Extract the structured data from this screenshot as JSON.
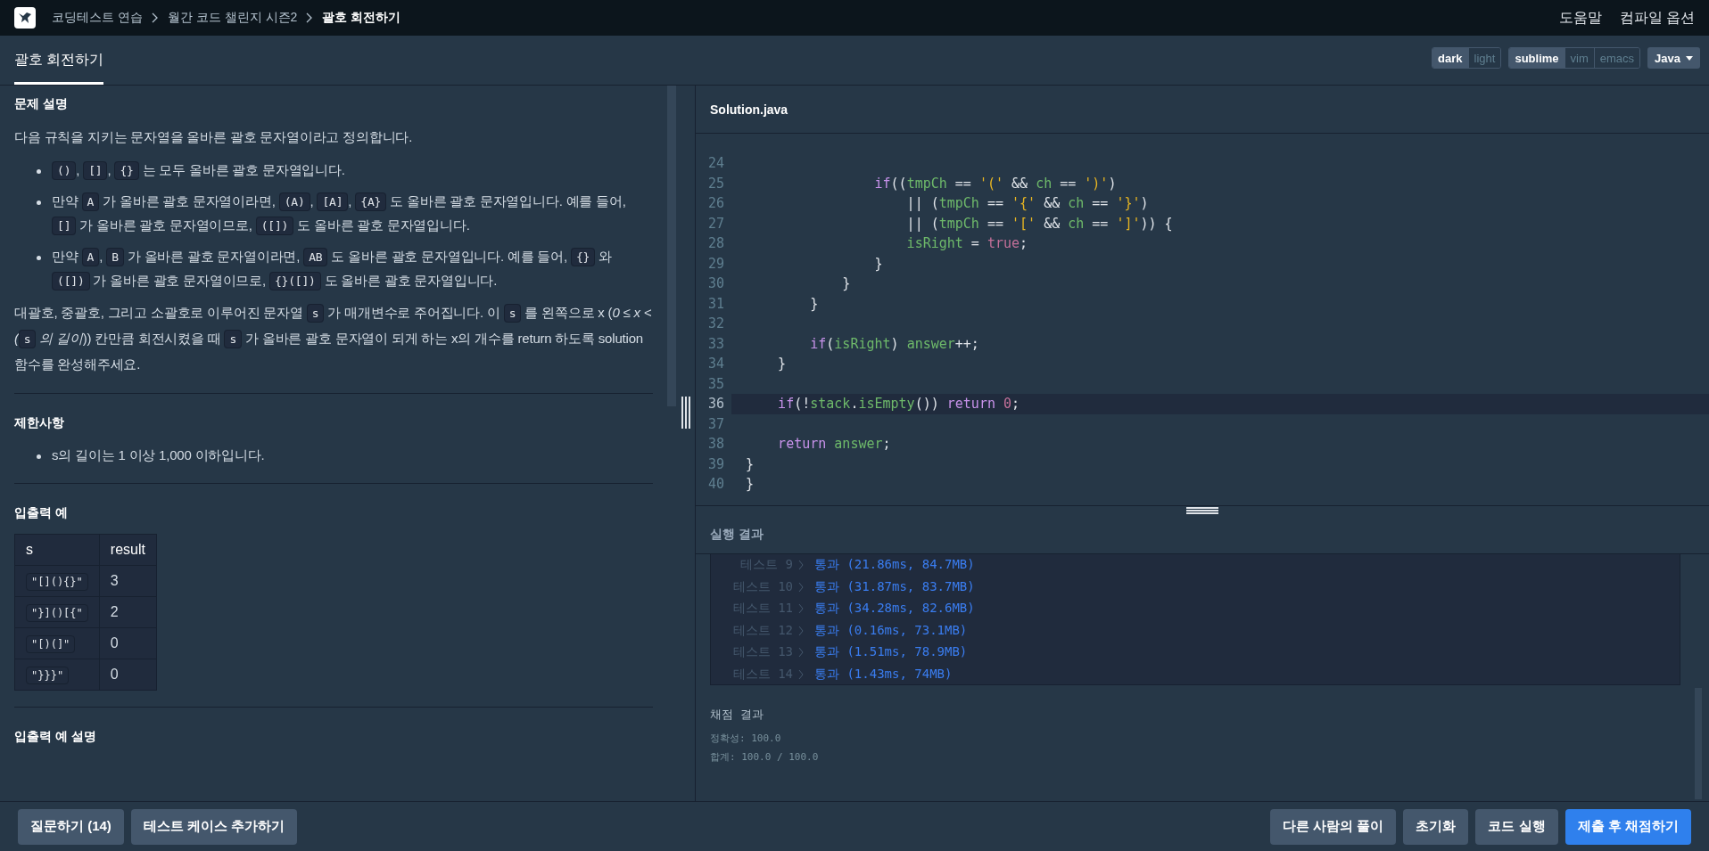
{
  "breadcrumb": [
    {
      "label": "코딩테스트 연습",
      "current": false
    },
    {
      "label": "월간 코드 챌린지 시즌2",
      "current": false
    },
    {
      "label": "괄호 회전하기",
      "current": true
    }
  ],
  "top_links": [
    "도움말",
    "컴파일 옵션"
  ],
  "tabs": [
    {
      "label": "괄호 회전하기",
      "selected": true
    }
  ],
  "theme_toggle": [
    {
      "label": "dark",
      "selected": true
    },
    {
      "label": "light",
      "selected": false
    }
  ],
  "keymap_toggle": [
    {
      "label": "sublime",
      "selected": true
    },
    {
      "label": "vim",
      "selected": false
    },
    {
      "label": "emacs",
      "selected": false
    }
  ],
  "language": {
    "label": "Java"
  },
  "problem": {
    "sections": [
      {
        "heading": "문제 설명",
        "blocks": [
          {
            "kind": "para",
            "segments": [
              {
                "kind": "text",
                "text": "다음 규칙을 지키는 문자열을 올바른 괄호 문자열이라고 정의합니다."
              }
            ]
          },
          {
            "kind": "list",
            "items": [
              [
                {
                  "kind": "code",
                  "text": "()"
                },
                {
                  "kind": "text",
                  "text": ", "
                },
                {
                  "kind": "code",
                  "text": "[]"
                },
                {
                  "kind": "text",
                  "text": ", "
                },
                {
                  "kind": "code",
                  "text": "{}"
                },
                {
                  "kind": "text",
                  "text": " 는 모두 올바른 괄호 문자열입니다."
                }
              ],
              [
                {
                  "kind": "text",
                  "text": "만약 "
                },
                {
                  "kind": "code",
                  "text": "A"
                },
                {
                  "kind": "text",
                  "text": " 가 올바른 괄호 문자열이라면, "
                },
                {
                  "kind": "code",
                  "text": "(A)"
                },
                {
                  "kind": "text",
                  "text": ", "
                },
                {
                  "kind": "code",
                  "text": "[A]"
                },
                {
                  "kind": "text",
                  "text": ", "
                },
                {
                  "kind": "code",
                  "text": "{A}"
                },
                {
                  "kind": "text",
                  "text": " 도 올바른 괄호 문자열입니다. 예를 들어, "
                },
                {
                  "kind": "code",
                  "text": "[]"
                },
                {
                  "kind": "text",
                  "text": " 가 올바른 괄호 문자열이므로, "
                },
                {
                  "kind": "code",
                  "text": "([])"
                },
                {
                  "kind": "text",
                  "text": " 도 올바른 괄호 문자열입니다."
                }
              ],
              [
                {
                  "kind": "text",
                  "text": "만약 "
                },
                {
                  "kind": "code",
                  "text": "A"
                },
                {
                  "kind": "text",
                  "text": ", "
                },
                {
                  "kind": "code",
                  "text": "B"
                },
                {
                  "kind": "text",
                  "text": " 가 올바른 괄호 문자열이라면, "
                },
                {
                  "kind": "code",
                  "text": "AB"
                },
                {
                  "kind": "text",
                  "text": " 도 올바른 괄호 문자열입니다. 예를 들어, "
                },
                {
                  "kind": "code",
                  "text": "{}"
                },
                {
                  "kind": "text",
                  "text": " 와 "
                },
                {
                  "kind": "code",
                  "text": "([])"
                },
                {
                  "kind": "text",
                  "text": " 가 올바른 괄호 문자열이므로, "
                },
                {
                  "kind": "code",
                  "text": "{}([])"
                },
                {
                  "kind": "text",
                  "text": " 도 올바른 괄호 문자열입니다."
                }
              ]
            ]
          },
          {
            "kind": "para",
            "segments": [
              {
                "kind": "text",
                "text": "대괄호, 중괄호, 그리고 소괄호로 이루어진 문자열 "
              },
              {
                "kind": "code",
                "text": "s"
              },
              {
                "kind": "text",
                "text": " 가 매개변수로 주어집니다. 이 "
              },
              {
                "kind": "code",
                "text": "s"
              },
              {
                "kind": "text",
                "text": " 를 왼쪽으로 x ("
              },
              {
                "kind": "em",
                "text": "0 ≤ x < ("
              },
              {
                "kind": "code",
                "text": "s"
              },
              {
                "kind": "em",
                "text": " 의 길이"
              },
              {
                "kind": "text",
                "text": ")) 칸만큼 회전시켰을 때 "
              },
              {
                "kind": "code",
                "text": "s"
              },
              {
                "kind": "text",
                "text": " 가 올바른 괄호 문자열이 되게 하는 x의 개수를 return 하도록 solution 함수를 완성해주세요."
              }
            ]
          }
        ]
      },
      {
        "heading": "제한사항",
        "blocks": [
          {
            "kind": "list",
            "items": [
              [
                {
                  "kind": "text",
                  "text": "s의 길이는 1 이상 1,000 이하입니다."
                }
              ]
            ]
          }
        ]
      },
      {
        "heading": "입출력 예",
        "blocks": [
          {
            "kind": "table",
            "columns": [
              "s",
              "result"
            ],
            "rows": [
              [
                "\"[](){}\"",
                "3"
              ],
              [
                "\"}]()[{\"",
                "2"
              ],
              [
                "\"[)(]\"",
                "0"
              ],
              [
                "\"}}}\"",
                "0"
              ]
            ]
          }
        ]
      },
      {
        "heading": "입출력 예 설명"
      }
    ]
  },
  "editor": {
    "filename": "Solution.java",
    "lines": [
      {
        "number": "24",
        "active": false
      },
      {
        "number": "25",
        "active": false,
        "tokens": [
          {
            "kind": "kw",
            "text": "                if"
          },
          {
            "kind": "plain",
            "text": "(("
          },
          {
            "kind": "var",
            "text": "tmpCh"
          },
          {
            "kind": "plain",
            "text": " == "
          },
          {
            "kind": "str",
            "text": "'('"
          },
          {
            "kind": "plain",
            "text": " && "
          },
          {
            "kind": "var",
            "text": "ch"
          },
          {
            "kind": "plain",
            "text": " == "
          },
          {
            "kind": "str",
            "text": "')'"
          },
          {
            "kind": "plain",
            "text": ")"
          }
        ]
      },
      {
        "number": "26",
        "active": false,
        "tokens": [
          {
            "kind": "plain",
            "text": "                    || ("
          },
          {
            "kind": "var",
            "text": "tmpCh"
          },
          {
            "kind": "plain",
            "text": " == "
          },
          {
            "kind": "str",
            "text": "'{'"
          },
          {
            "kind": "plain",
            "text": " && "
          },
          {
            "kind": "var",
            "text": "ch"
          },
          {
            "kind": "plain",
            "text": " == "
          },
          {
            "kind": "str",
            "text": "'}'"
          },
          {
            "kind": "plain",
            "text": ")"
          }
        ]
      },
      {
        "number": "27",
        "active": false,
        "tokens": [
          {
            "kind": "plain",
            "text": "                    || ("
          },
          {
            "kind": "var",
            "text": "tmpCh"
          },
          {
            "kind": "plain",
            "text": " == "
          },
          {
            "kind": "str",
            "text": "'['"
          },
          {
            "kind": "plain",
            "text": " && "
          },
          {
            "kind": "var",
            "text": "ch"
          },
          {
            "kind": "plain",
            "text": " == "
          },
          {
            "kind": "str",
            "text": "']'"
          },
          {
            "kind": "plain",
            "text": ")) {"
          }
        ]
      },
      {
        "number": "28",
        "active": false,
        "tokens": [
          {
            "kind": "var",
            "text": "                    isRight"
          },
          {
            "kind": "plain",
            "text": " = "
          },
          {
            "kind": "bool",
            "text": "true"
          },
          {
            "kind": "plain",
            "text": ";"
          }
        ]
      },
      {
        "number": "29",
        "active": false,
        "tokens": [
          {
            "kind": "plain",
            "text": "                }"
          }
        ]
      },
      {
        "number": "30",
        "active": false,
        "tokens": [
          {
            "kind": "plain",
            "text": "            }"
          }
        ]
      },
      {
        "number": "31",
        "active": false,
        "tokens": [
          {
            "kind": "plain",
            "text": "        }"
          }
        ]
      },
      {
        "number": "32",
        "active": false
      },
      {
        "number": "33",
        "active": false,
        "tokens": [
          {
            "kind": "kw",
            "text": "        if"
          },
          {
            "kind": "plain",
            "text": "("
          },
          {
            "kind": "var",
            "text": "isRight"
          },
          {
            "kind": "plain",
            "text": ") "
          },
          {
            "kind": "var",
            "text": "answer"
          },
          {
            "kind": "plain",
            "text": "++;"
          }
        ]
      },
      {
        "number": "34",
        "active": false,
        "tokens": [
          {
            "kind": "plain",
            "text": "    }"
          }
        ]
      },
      {
        "number": "35",
        "active": false
      },
      {
        "number": "36",
        "active": true,
        "tokens": [
          {
            "kind": "kw",
            "text": "    if"
          },
          {
            "kind": "plain",
            "text": "(!"
          },
          {
            "kind": "var",
            "text": "stack"
          },
          {
            "kind": "plain",
            "text": "."
          },
          {
            "kind": "var",
            "text": "isEmpty"
          },
          {
            "kind": "plain",
            "text": "()) "
          },
          {
            "kind": "kw",
            "text": "return"
          },
          {
            "kind": "bool",
            "text": " 0"
          },
          {
            "kind": "plain",
            "text": ";"
          }
        ]
      },
      {
        "number": "37",
        "active": false
      },
      {
        "number": "38",
        "active": false,
        "tokens": [
          {
            "kind": "kw",
            "text": "    return"
          },
          {
            "kind": "var",
            "text": " answer"
          },
          {
            "kind": "plain",
            "text": ";"
          }
        ]
      },
      {
        "number": "39",
        "active": false,
        "tokens": [
          {
            "kind": "plain",
            "text": "}"
          }
        ]
      },
      {
        "number": "40",
        "active": false,
        "tokens": [
          {
            "kind": "plain",
            "text": "}"
          }
        ]
      }
    ]
  },
  "results": {
    "title": "실행 결과",
    "tests": [
      {
        "label": "테스트 9",
        "result": "통과 (21.86ms, 84.7MB)"
      },
      {
        "label": "테스트 10",
        "result": "통과 (31.87ms, 83.7MB)"
      },
      {
        "label": "테스트 11",
        "result": "통과 (34.28ms, 82.6MB)"
      },
      {
        "label": "테스트 12",
        "result": "통과 (0.16ms, 73.1MB)"
      },
      {
        "label": "테스트 13",
        "result": "통과 (1.51ms, 78.9MB)"
      },
      {
        "label": "테스트 14",
        "result": "통과 (1.43ms, 74MB)"
      }
    ],
    "score_title": "채점 결과",
    "score_lines": [
      "정확성: 100.0",
      "합계: 100.0 / 100.0"
    ]
  },
  "left_buttons": [
    "질문하기 (14)",
    "테스트 케이스 추가하기"
  ],
  "right_buttons": [
    {
      "label": "다른 사람의 풀이",
      "kind": "normal"
    },
    {
      "label": "초기화",
      "kind": "normal"
    },
    {
      "label": "코드 실행",
      "kind": "normal"
    },
    {
      "label": "제출 후 채점하기",
      "kind": "primary"
    }
  ]
}
